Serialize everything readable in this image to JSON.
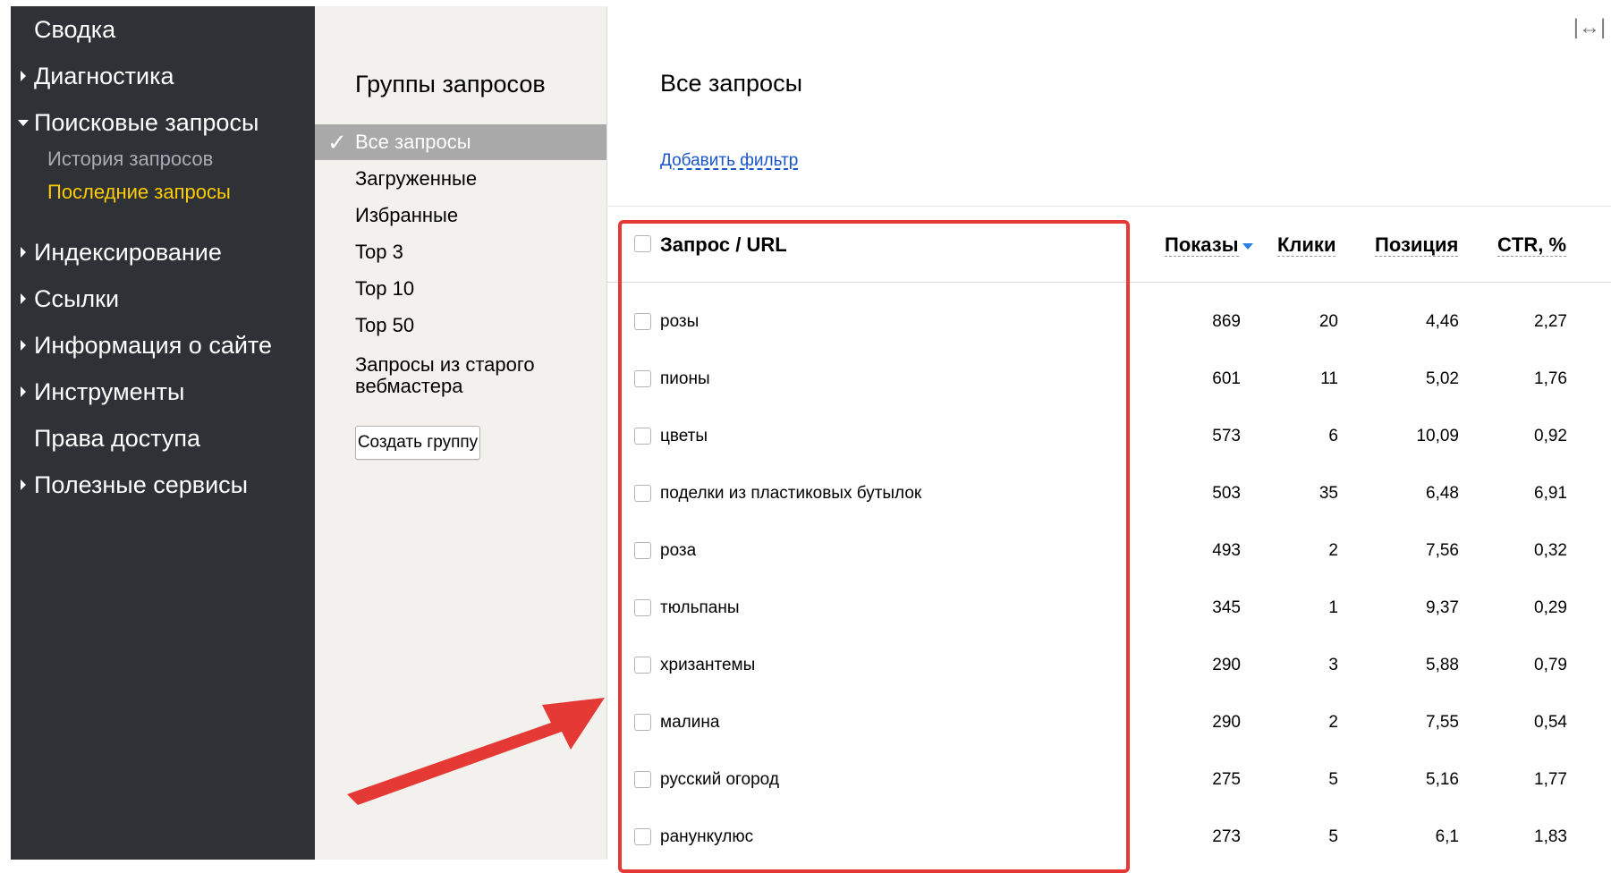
{
  "sidebar": {
    "items": [
      {
        "label": "Сводка",
        "arrow": "none"
      },
      {
        "label": "Диагностика",
        "arrow": "right"
      },
      {
        "label": "Поисковые запросы",
        "arrow": "down"
      },
      {
        "label": "Индексирование",
        "arrow": "right"
      },
      {
        "label": "Ссылки",
        "arrow": "right"
      },
      {
        "label": "Информация о сайте",
        "arrow": "right"
      },
      {
        "label": "Инструменты",
        "arrow": "right"
      },
      {
        "label": "Права доступа",
        "arrow": "none"
      },
      {
        "label": "Полезные сервисы",
        "arrow": "right"
      }
    ],
    "subitems": [
      {
        "label": "История запросов",
        "state": "normal"
      },
      {
        "label": "Последние запросы",
        "state": "active"
      }
    ],
    "colors": {
      "background": "#2e3237",
      "active_subitem": "#ffcc00"
    }
  },
  "groups": {
    "title": "Группы запросов",
    "items": [
      {
        "label": "Все запросы",
        "selected": true
      },
      {
        "label": "Загруженные"
      },
      {
        "label": "Избранные"
      },
      {
        "label": "Top 3"
      },
      {
        "label": "Top 10"
      },
      {
        "label": "Top 50"
      },
      {
        "label": "Запросы из старого вебмастера"
      }
    ],
    "create_button": "Создать группу",
    "check_icon": "checkmark-icon"
  },
  "main": {
    "title": "Все запросы",
    "add_filter": "Добавить фильтр",
    "expand_icon_glyph": "|↔|"
  },
  "table": {
    "columns": {
      "query": "Запрос / URL",
      "shows": "Показы",
      "clicks": "Клики",
      "position": "Позиция",
      "ctr": "CTR, %"
    },
    "sort_column": "shows",
    "sort_color": "#2b7de0",
    "rows": [
      {
        "query": "розы",
        "shows": "869",
        "clicks": "20",
        "position": "4,46",
        "ctr": "2,27"
      },
      {
        "query": "пионы",
        "shows": "601",
        "clicks": "11",
        "position": "5,02",
        "ctr": "1,76"
      },
      {
        "query": "цветы",
        "shows": "573",
        "clicks": "6",
        "position": "10,09",
        "ctr": "0,92"
      },
      {
        "query": "поделки из пластиковых бутылок",
        "shows": "503",
        "clicks": "35",
        "position": "6,48",
        "ctr": "6,91"
      },
      {
        "query": "роза",
        "shows": "493",
        "clicks": "2",
        "position": "7,56",
        "ctr": "0,32"
      },
      {
        "query": "тюльпаны",
        "shows": "345",
        "clicks": "1",
        "position": "9,37",
        "ctr": "0,29"
      },
      {
        "query": "хризантемы",
        "shows": "290",
        "clicks": "3",
        "position": "5,88",
        "ctr": "0,79"
      },
      {
        "query": "малина",
        "shows": "290",
        "clicks": "2",
        "position": "7,55",
        "ctr": "0,54"
      },
      {
        "query": "русский огород",
        "shows": "275",
        "clicks": "5",
        "position": "5,16",
        "ctr": "1,77"
      },
      {
        "query": "ранункулюс",
        "shows": "273",
        "clicks": "5",
        "position": "6,1",
        "ctr": "1,83"
      }
    ]
  },
  "annotation": {
    "color": "#e53935"
  }
}
